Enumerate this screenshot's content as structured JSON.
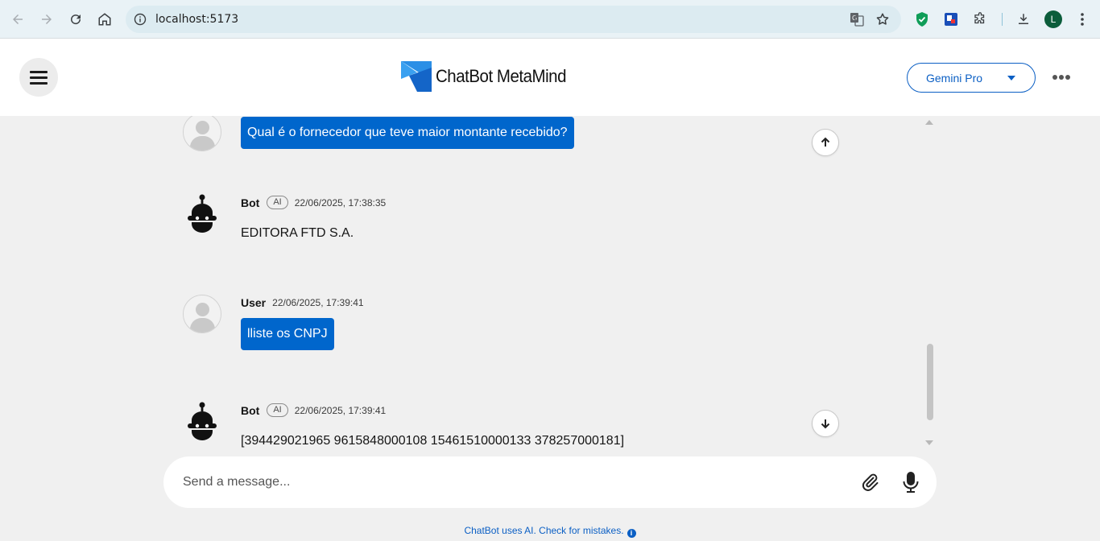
{
  "browser": {
    "url": "localhost:5173",
    "profile_initial": "L"
  },
  "header": {
    "brand": "ChatBot MetaMind",
    "model": "Gemini Pro",
    "accent_color": "#0066cc"
  },
  "messages": [
    {
      "role": "user",
      "sender": "",
      "timestamp": "",
      "text": "Qual é o fornecedor que teve maior montante recebido?"
    },
    {
      "role": "bot",
      "sender": "Bot",
      "badge": "AI",
      "timestamp": "22/06/2025, 17:38:35",
      "text": "EDITORA FTD S.A."
    },
    {
      "role": "user",
      "sender": "User",
      "timestamp": "22/06/2025, 17:39:41",
      "text": "lliste os CNPJ"
    },
    {
      "role": "bot",
      "sender": "Bot",
      "badge": "AI",
      "timestamp": "22/06/2025, 17:39:41",
      "text": "[394429021965 9615848000108 15461510000133 378257000181]"
    }
  ],
  "composer": {
    "placeholder": "Send a message..."
  },
  "footer": {
    "note": "ChatBot uses AI. Check for mistakes.",
    "info_glyph": "i"
  }
}
